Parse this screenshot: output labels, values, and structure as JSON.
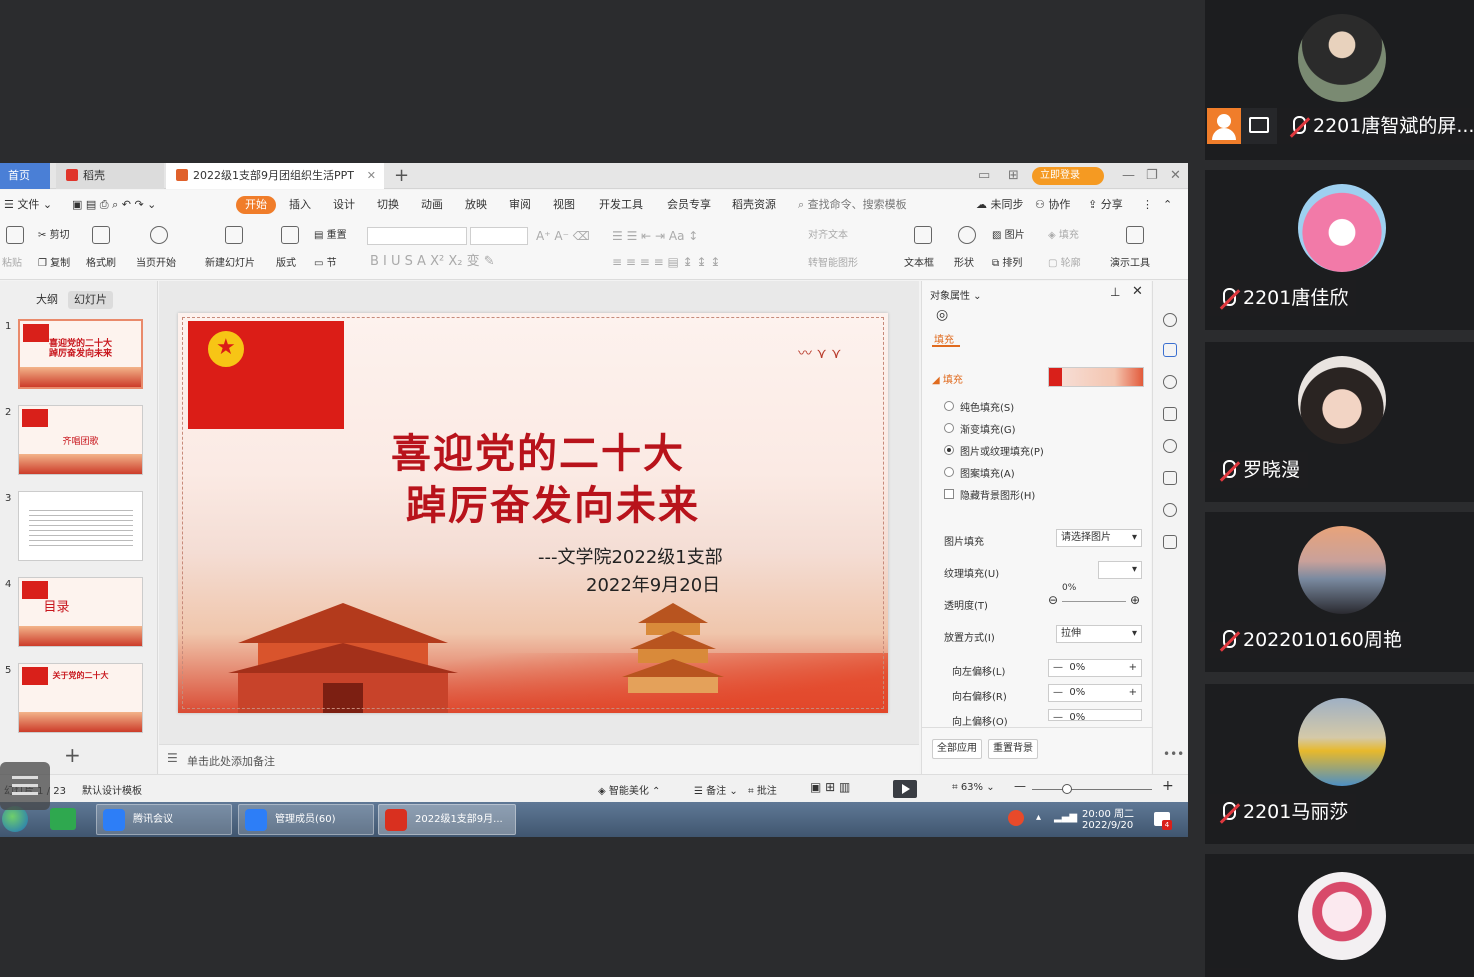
{
  "tabs": {
    "home": "首页",
    "docer": "稻壳",
    "doc": "2022级1支部9月团组织生活PPT",
    "login": "立即登录"
  },
  "menu": {
    "file": "文件",
    "items": [
      "开始",
      "插入",
      "设计",
      "切换",
      "动画",
      "放映",
      "审阅",
      "视图",
      "开发工具",
      "会员专享",
      "稻壳资源"
    ],
    "search": "查找命令、搜索模板",
    "unsynced": "未同步",
    "collab": "协作",
    "share": "分享"
  },
  "toolbar": {
    "paste": "粘贴",
    "cut": "剪切",
    "copy": "复制",
    "format_painter": "格式刷",
    "play_from_current": "当页开始",
    "new_slide": "新建幻灯片",
    "layout": "版式",
    "reset": "重置",
    "section": "节",
    "align_text": "对齐文本",
    "convert_smartart": "转智能图形",
    "textbox": "文本框",
    "shape": "形状",
    "picture": "图片",
    "fill": "填充",
    "arrange": "排列",
    "outline": "轮廓",
    "presentation_tools": "演示工具"
  },
  "left_panel": {
    "outline_tab": "大纲",
    "slides_tab": "幻灯片",
    "thumbs": [
      {
        "num": "1",
        "title": "喜迎党的二十大\n踔厉奋发向未来"
      },
      {
        "num": "2",
        "title": "齐唱团歌"
      },
      {
        "num": "3",
        "title": ""
      },
      {
        "num": "4",
        "title": "目录"
      },
      {
        "num": "5",
        "title": "关于党的二十大"
      }
    ]
  },
  "slide": {
    "title_line1": "喜迎党的二十大",
    "title_line2": "踔厉奋发向未来",
    "subtitle_line1": "---文学院2022级1支部",
    "subtitle_line2": "2022年9月20日"
  },
  "notes_placeholder": "单击此处添加备注",
  "props": {
    "header": "对象属性",
    "fill_tab": "填充",
    "fill_section": "填充",
    "options": [
      "纯色填充(S)",
      "渐变填充(G)",
      "图片或纹理填充(P)",
      "图案填充(A)"
    ],
    "selected_option": "图片或纹理填充(P)",
    "hide_bg": "隐藏背景图形(H)",
    "picture_fill_label": "图片填充",
    "picture_fill_value": "请选择图片",
    "texture_fill_label": "纹理填充(U)",
    "transparency_label": "透明度(T)",
    "transparency_value": "0%",
    "placement_label": "放置方式(I)",
    "placement_value": "拉伸",
    "offset_left_label": "向左偏移(L)",
    "offset_left_value": "0%",
    "offset_right_label": "向右偏移(R)",
    "offset_right_value": "0%",
    "offset_up_label": "向上偏移(O)",
    "offset_up_value": "0%",
    "apply_all": "全部应用",
    "reset_bg": "重置背景"
  },
  "status": {
    "slide_counter": "幻灯片 1 / 23",
    "template": "默认设计模板",
    "beautify": "智能美化",
    "notes": "备注",
    "comments": "批注",
    "zoom": "63%"
  },
  "taskbar": {
    "apps": [
      "腾讯会议",
      "管理成员(60)",
      "2022级1支部9月..."
    ],
    "time": "20:00 周二",
    "date": "2022/9/20",
    "badge": "4"
  },
  "participants": [
    {
      "name": "2201唐智斌的屏..."
    },
    {
      "name": "2201唐佳欣"
    },
    {
      "name": "罗晓漫"
    },
    {
      "name": "2022010160周艳"
    },
    {
      "name": "2201马丽莎"
    },
    {
      "name": ""
    }
  ],
  "colors": {
    "accent_orange": "#f07d2a",
    "flag_red": "#db1d17",
    "title_red": "#b8131b",
    "muted_red": "#e0383e"
  }
}
